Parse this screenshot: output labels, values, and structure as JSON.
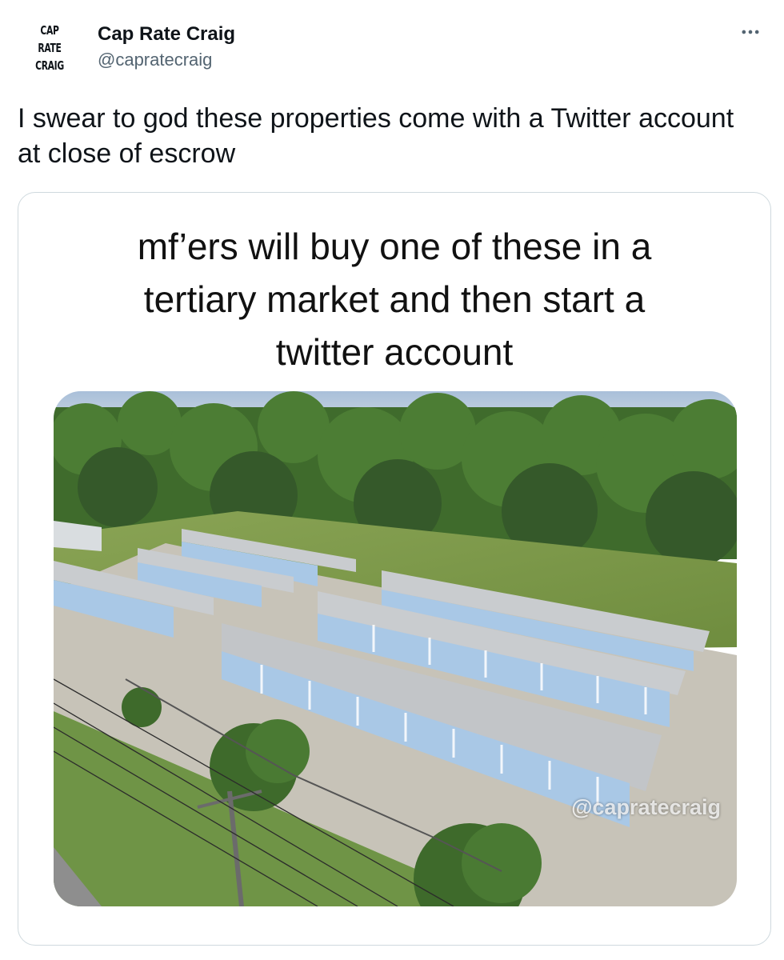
{
  "tweet": {
    "avatar_text": [
      "CAP",
      "RATE",
      "CRAIG"
    ],
    "display_name": "Cap Rate Craig",
    "handle": "@capratecraig",
    "text": "I swear to god these properties come with a Twitter account at close of escrow",
    "more_icon": "ellipsis-icon"
  },
  "media": {
    "caption_lines": [
      "mf’ers will buy one of these in a",
      "tertiary market and then start a",
      "twitter account"
    ],
    "watermark": "@capratecraig"
  },
  "colors": {
    "text": "#0f1419",
    "secondary": "#536471",
    "border": "#cfd9de",
    "grass": "#7f9a4a",
    "trees": "#3f6b2c",
    "unit_doors": "#a9c8e6",
    "roof": "#c9cccf"
  }
}
